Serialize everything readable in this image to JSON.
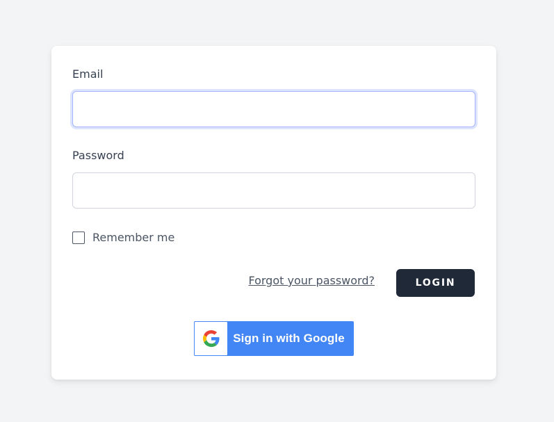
{
  "form": {
    "email_label": "Email",
    "email_value": "",
    "password_label": "Password",
    "password_value": "",
    "remember_label": "Remember me",
    "remember_checked": false,
    "forgot_link": "Forgot your password?",
    "login_button": "LOGIN"
  },
  "google": {
    "label": "Sign in with Google",
    "icon": "google-g-logo",
    "color": "#4285f4"
  },
  "colors": {
    "background": "#f3f4f6",
    "card": "#ffffff",
    "login_button": "#1f2937",
    "focus_ring": "#a5b4fc"
  }
}
